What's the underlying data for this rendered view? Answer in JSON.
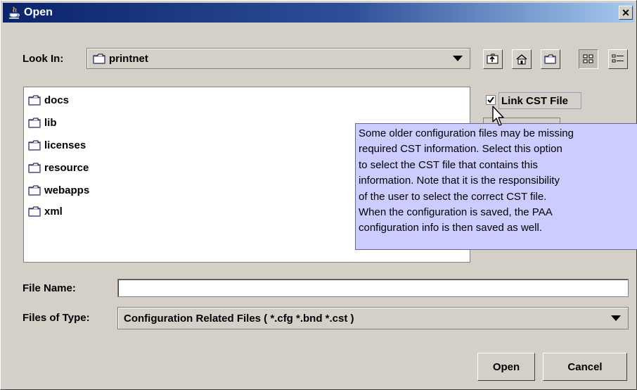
{
  "window": {
    "title": "Open",
    "close_glyph": "✕"
  },
  "look_in": {
    "label": "Look In:",
    "selected": "printnet"
  },
  "toolbar": {
    "icons": [
      "up-one-level-icon",
      "home-icon",
      "new-folder-icon",
      "list-view-icon",
      "details-view-icon"
    ]
  },
  "files": [
    {
      "name": "docs"
    },
    {
      "name": "lib"
    },
    {
      "name": "licenses"
    },
    {
      "name": "resource"
    },
    {
      "name": "webapps"
    },
    {
      "name": "xml"
    }
  ],
  "link_cst": {
    "label": "Link CST File",
    "checked": true
  },
  "tooltip": {
    "lines": [
      "Some older configuration files may be missing",
      "required CST information. Select this option",
      "to select the CST file that contains this",
      "information. Note that it is the responsibility",
      "of the user to select the correct CST file.",
      "When the configuration is saved, the PAA",
      "configuration info is then saved as well."
    ]
  },
  "file_name": {
    "label": "File Name:",
    "value": ""
  },
  "files_of_type": {
    "label": "Files of Type:",
    "selected": "Configuration Related Files ( *.cfg *.bnd *.cst )"
  },
  "buttons": {
    "open": "Open",
    "cancel": "Cancel"
  },
  "colors": {
    "tooltip_bg": "#ccccff",
    "window_bg": "#d4d0c8",
    "title_bar": "#0a246a"
  }
}
